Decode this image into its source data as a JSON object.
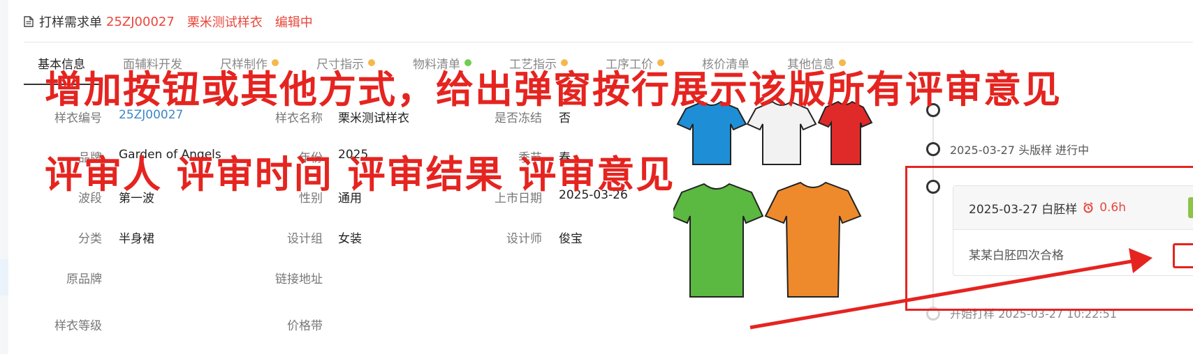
{
  "header": {
    "title_prefix": "打样需求单",
    "code": "25ZJ00027",
    "name": "栗米测试样衣",
    "status": "编辑中"
  },
  "tabs": [
    {
      "label": "基本信息",
      "active": true,
      "dot": ""
    },
    {
      "label": "面辅料开发",
      "active": false,
      "dot": ""
    },
    {
      "label": "尺样制作",
      "active": false,
      "dot": "orange"
    },
    {
      "label": "尺寸指示",
      "active": false,
      "dot": "orange"
    },
    {
      "label": "物料清单",
      "active": false,
      "dot": "green"
    },
    {
      "label": "工艺指示",
      "active": false,
      "dot": "orange"
    },
    {
      "label": "工序工价",
      "active": false,
      "dot": "orange"
    },
    {
      "label": "核价清单",
      "active": false,
      "dot": ""
    },
    {
      "label": "其他信息",
      "active": false,
      "dot": "orange"
    }
  ],
  "annotation": {
    "line1": "增加按钮或其他方式，给出弹窗按行展示该版所有评审意见",
    "line2": "评审人 评审时间 评审结果 评审意见",
    "color": "#e52420"
  },
  "fields": {
    "sample_no": {
      "label": "样衣编号",
      "value": "25ZJ00027"
    },
    "sample_name": {
      "label": "样衣名称",
      "value": "栗米测试样衣"
    },
    "frozen": {
      "label": "是否冻结",
      "value": "否"
    },
    "brand": {
      "label": "品牌",
      "value": "Garden of Angels"
    },
    "year": {
      "label": "年份",
      "value": "2025"
    },
    "season": {
      "label": "季节",
      "value": "春"
    },
    "wave": {
      "label": "波段",
      "value": "第一波"
    },
    "gender": {
      "label": "性别",
      "value": "通用"
    },
    "launch_date": {
      "label": "上市日期",
      "value": "2025-03-26"
    },
    "category": {
      "label": "分类",
      "value": "半身裙"
    },
    "design_group": {
      "label": "设计组",
      "value": "女装"
    },
    "designer": {
      "label": "设计师",
      "value": "俊宝"
    },
    "original_brand": {
      "label": "原品牌",
      "value": ""
    },
    "link": {
      "label": "链接地址",
      "value": ""
    },
    "sample_level": {
      "label": "样衣等级",
      "value": ""
    },
    "price_band": {
      "label": "价格带",
      "value": ""
    }
  },
  "timeline": {
    "item1": "2025-03-27 头版样 进行中",
    "card_title": "2025-03-27 白胚样",
    "card_time": "0.6h",
    "card_body": "某某白胚四次合格",
    "start": "开始打样 2025-03-27 10:22:51"
  }
}
